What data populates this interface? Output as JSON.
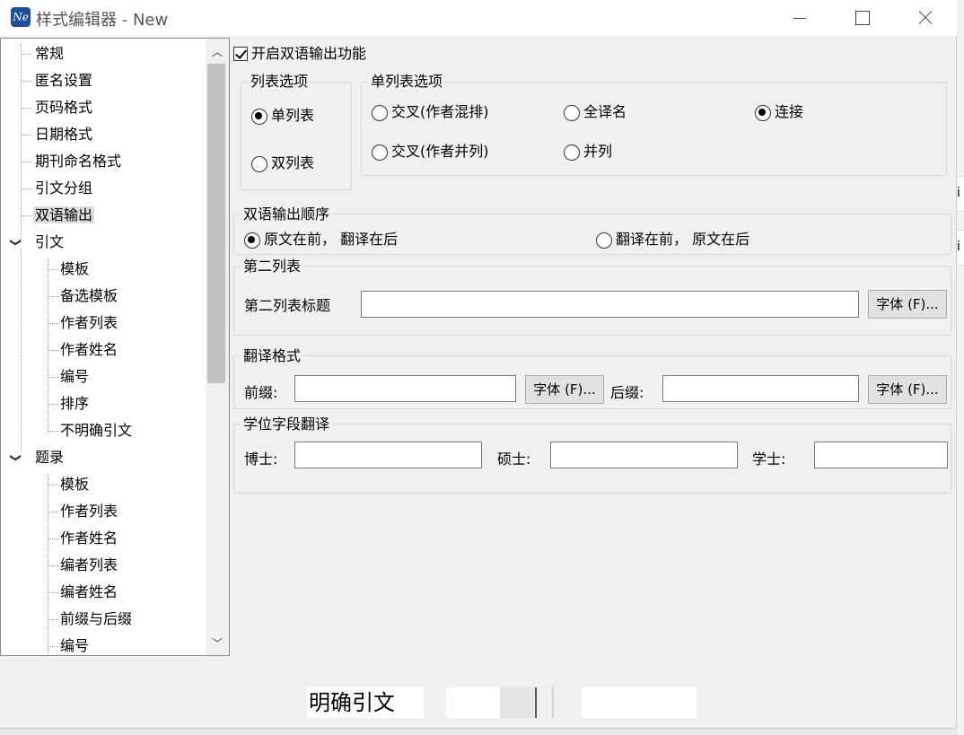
{
  "window": {
    "title": "样式编辑器 - New",
    "icon_text": "Ne"
  },
  "tree": {
    "items": [
      {
        "label": "常规"
      },
      {
        "label": "匿名设置"
      },
      {
        "label": "页码格式"
      },
      {
        "label": "日期格式"
      },
      {
        "label": "期刊命名格式"
      },
      {
        "label": "引文分组"
      },
      {
        "label": "双语输出",
        "selected": true
      },
      {
        "label": "引文",
        "expanded": true
      },
      {
        "label": "模板"
      },
      {
        "label": "备选模板"
      },
      {
        "label": "作者列表"
      },
      {
        "label": "作者姓名"
      },
      {
        "label": "编号"
      },
      {
        "label": "排序"
      },
      {
        "label": "不明确引文"
      },
      {
        "label": "题录",
        "expanded": true
      },
      {
        "label": "模板"
      },
      {
        "label": "作者列表"
      },
      {
        "label": "作者姓名"
      },
      {
        "label": "编者列表"
      },
      {
        "label": "编者姓名"
      },
      {
        "label": "前缀与后缀"
      },
      {
        "label": "编号"
      }
    ]
  },
  "bilingual": {
    "enable_label": "开启双语输出功能",
    "enabled": true,
    "list_options": {
      "legend": "列表选项",
      "single": "单列表",
      "double": "双列表",
      "selected": "single"
    },
    "single_list_options": {
      "legend": "单列表选项",
      "cross_mixed": "交叉(作者混排)",
      "cross_parallel": "交叉(作者并列)",
      "full_translation": "全译名",
      "parallel": "并列",
      "connect": "连接",
      "selected": "connect"
    },
    "output_order": {
      "legend": "双语输出顺序",
      "original_first": "原文在前， 翻译在后",
      "translation_first": "翻译在前， 原文在后",
      "selected": "original_first"
    },
    "second_list": {
      "legend": "第二列表",
      "title_label": "第二列表标题",
      "title_value": "",
      "font_button": "字体 (F)..."
    },
    "translation_format": {
      "legend": "翻译格式",
      "prefix_label": "前缀:",
      "prefix_value": "",
      "prefix_font_button": "字体 (F)...",
      "suffix_label": "后缀:",
      "suffix_value": "",
      "suffix_font_button": "字体 (F)..."
    },
    "degree_translation": {
      "legend": "学位字段翻译",
      "doctor_label": "博士:",
      "doctor_value": "",
      "master_label": "硕士:",
      "master_value": "",
      "bachelor_label": "学士:",
      "bachelor_value": ""
    }
  },
  "background": {
    "bottom_text": "明确引文",
    "edge_char_1": "i",
    "edge_char_2": "i"
  }
}
